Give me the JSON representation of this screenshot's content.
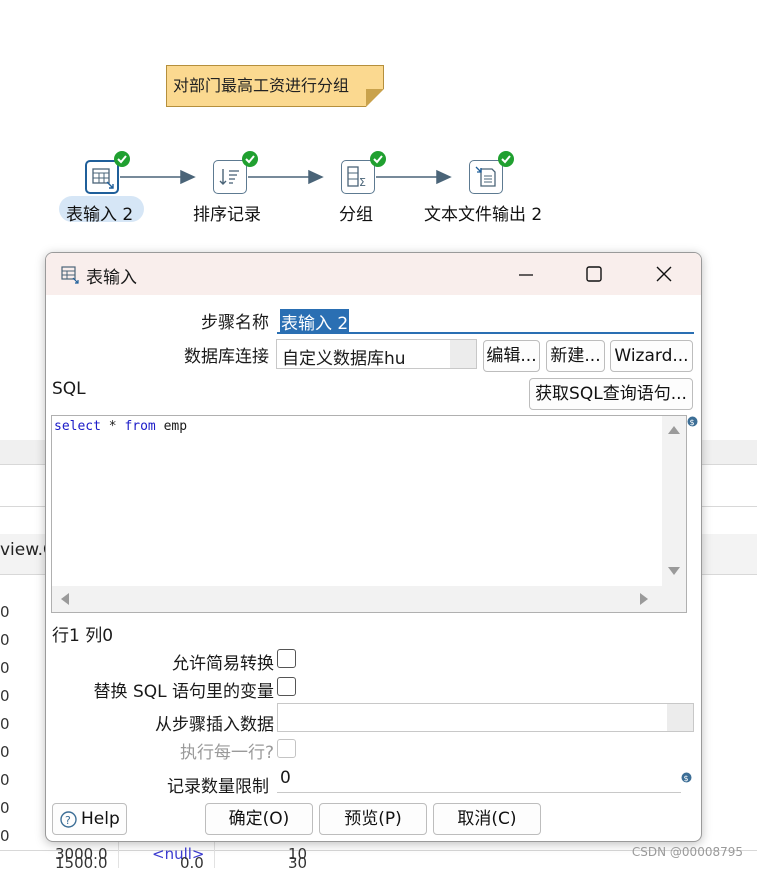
{
  "note": {
    "text": "对部门最高工资进行分组"
  },
  "flow": {
    "steps": [
      {
        "label": "表输入 2"
      },
      {
        "label": "排序记录"
      },
      {
        "label": "分组"
      },
      {
        "label": "文本文件输出 2"
      }
    ]
  },
  "background": {
    "fragment": "view.C",
    "zeros": [
      "0",
      "0",
      "0",
      "0",
      "0",
      "0",
      "0",
      "0",
      "0"
    ],
    "bottom_cells": [
      "3000.0",
      "<null>",
      "10",
      "1500.0",
      "0.0",
      "30"
    ]
  },
  "dialog": {
    "title": "表输入",
    "step_name_label": "步骤名称",
    "step_name_value": "表输入 2",
    "db_connection_label": "数据库连接",
    "db_connection_value": "自定义数据库hu",
    "edit_button": "编辑...",
    "new_button": "新建...",
    "wizard_button": "Wizard...",
    "sql_label": "SQL",
    "get_sql_button": "获取SQL查询语句...",
    "sql": {
      "kw1": "select",
      "star": " * ",
      "kw2": "from",
      "rest": " emp"
    },
    "cursor_position": "行1 列0",
    "lazy_conversion_label": "允许简易转换",
    "replace_vars_label": "替换 SQL 语句里的变量",
    "insert_from_step_label": "从步骤插入数据",
    "execute_each_row_label": "执行每一行?",
    "limit_label": "记录数量限制",
    "limit_value": "0",
    "help_button": "Help",
    "ok_button": "确定(O)",
    "preview_button": "预览(P)",
    "cancel_button": "取消(C)"
  },
  "watermark": "CSDN @00008795"
}
